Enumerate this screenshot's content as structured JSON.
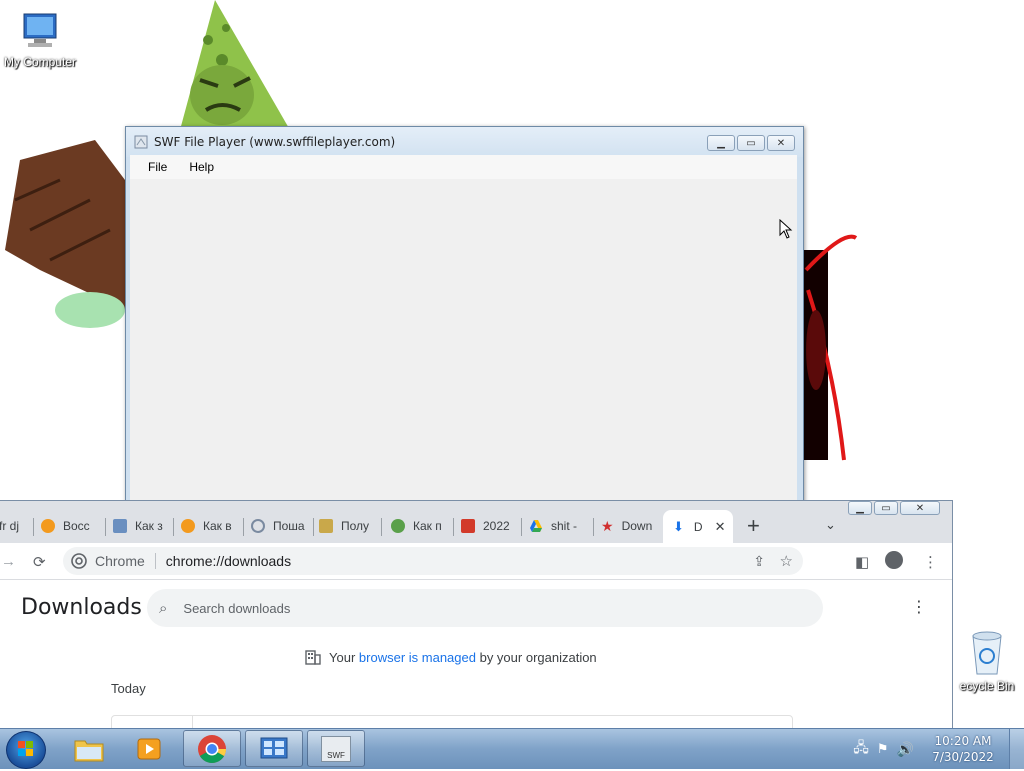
{
  "desktop": {
    "icons": [
      {
        "label": "My Computer"
      },
      {
        "label": "ecycle Bin"
      }
    ]
  },
  "swf_window": {
    "title": "SWF File Player (www.swffileplayer.com)",
    "menu": [
      "File",
      "Help"
    ]
  },
  "chrome": {
    "tabs": [
      {
        "label": "fr dj"
      },
      {
        "label": "Восс"
      },
      {
        "label": "Как з"
      },
      {
        "label": "Как в"
      },
      {
        "label": "Поша"
      },
      {
        "label": "Полу"
      },
      {
        "label": "Как п"
      },
      {
        "label": "2022"
      },
      {
        "label": "shit -"
      },
      {
        "label": "Down"
      },
      {
        "label": "D"
      }
    ],
    "new_tab": "+",
    "omnibox": {
      "site_chip": "Chrome",
      "url": "chrome://downloads"
    },
    "page": {
      "title": "Downloads",
      "search_placeholder": "Search downloads",
      "managed_prefix": "Your",
      "managed_link": "browser is managed",
      "managed_suffix": "by your organization",
      "section": "Today"
    }
  },
  "taskbar": {
    "apps": [
      {
        "icon": "explorer-icon"
      },
      {
        "icon": "media-player-icon"
      },
      {
        "icon": "chrome-icon"
      },
      {
        "icon": "control-panel-icon"
      },
      {
        "icon": "swf-player-icon",
        "label": "SWF"
      }
    ],
    "clock": {
      "time": "10:20 AM",
      "date": "7/30/2022"
    }
  }
}
